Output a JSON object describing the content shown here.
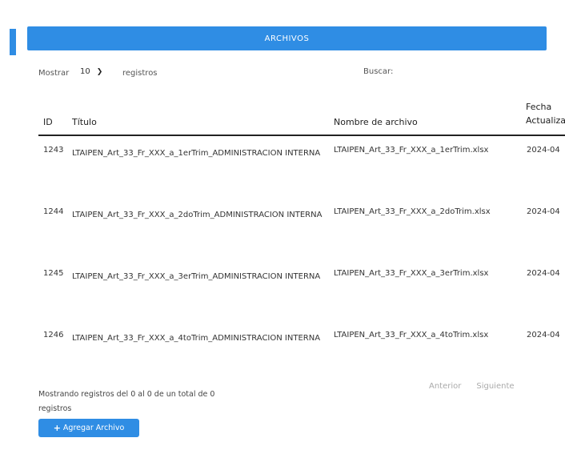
{
  "header": {
    "title": "ARCHIVOS"
  },
  "controls": {
    "show_label": "Mostrar",
    "page_size": "10",
    "rows_label": "registros",
    "search_label": "Buscar:"
  },
  "table": {
    "columns": {
      "id": "ID",
      "title": "Título",
      "file": "Nombre de archivo",
      "date_line1": "Fecha",
      "date_line2": "Actualiza"
    },
    "rows": [
      {
        "id": "1243",
        "title": "LTAIPEN_Art_33_Fr_XXX_a_1erTrim_ADMINISTRACION INTERNA",
        "file": "LTAIPEN_Art_33_Fr_XXX_a_1erTrim.xlsx",
        "date": "2024-04"
      },
      {
        "id": "1244",
        "title": "LTAIPEN_Art_33_Fr_XXX_a_2doTrim_ADMINISTRACION INTERNA",
        "file": "LTAIPEN_Art_33_Fr_XXX_a_2doTrim.xlsx",
        "date": "2024-04"
      },
      {
        "id": "1245",
        "title": "LTAIPEN_Art_33_Fr_XXX_a_3erTrim_ADMINISTRACION INTERNA",
        "file": "LTAIPEN_Art_33_Fr_XXX_a_3erTrim.xlsx",
        "date": "2024-04"
      },
      {
        "id": "1246",
        "title": "LTAIPEN_Art_33_Fr_XXX_a_4toTrim_ADMINISTRACION INTERNA",
        "file": "LTAIPEN_Art_33_Fr_XXX_a_4toTrim.xlsx",
        "date": "2024-04"
      }
    ]
  },
  "footer": {
    "info": "Mostrando registros del 0 al 0 de un total de 0 registros",
    "prev": "Anterior",
    "next": "Siguiente"
  },
  "add_button": {
    "label": "Agregar Archivo",
    "icon": "plus-icon"
  },
  "colors": {
    "accent": "#2f8de4"
  }
}
